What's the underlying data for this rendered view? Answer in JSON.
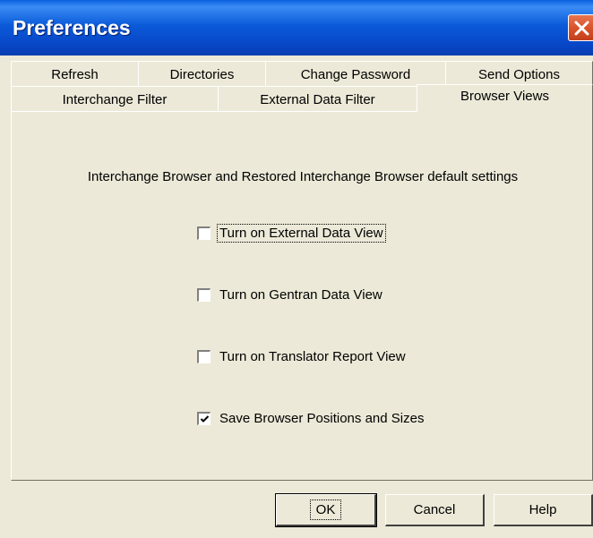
{
  "window": {
    "title": "Preferences"
  },
  "tabs": {
    "row1": [
      {
        "label": "Refresh"
      },
      {
        "label": "Directories"
      },
      {
        "label": "Change Password"
      },
      {
        "label": "Send Options"
      }
    ],
    "row2": [
      {
        "label": "Interchange Filter"
      },
      {
        "label": "External Data Filter"
      },
      {
        "label": "Browser Views",
        "active": true
      }
    ]
  },
  "panel": {
    "section_label": "Interchange Browser and Restored Interchange Browser default settings",
    "options": [
      {
        "label": "Turn on External Data View",
        "checked": false,
        "focused": true
      },
      {
        "label": "Turn on Gentran Data View",
        "checked": false
      },
      {
        "label": "Turn on Translator Report View",
        "checked": false
      },
      {
        "label": "Save Browser Positions and Sizes",
        "checked": true
      }
    ]
  },
  "buttons": {
    "ok": "OK",
    "cancel": "Cancel",
    "help": "Help"
  },
  "colors": {
    "title_bar": "#0A5FDD",
    "close_button": "#D9532C",
    "dialog_face": "#ECE9D8"
  },
  "icons": {
    "close": "close-icon",
    "checkmark": "checkmark-icon"
  }
}
